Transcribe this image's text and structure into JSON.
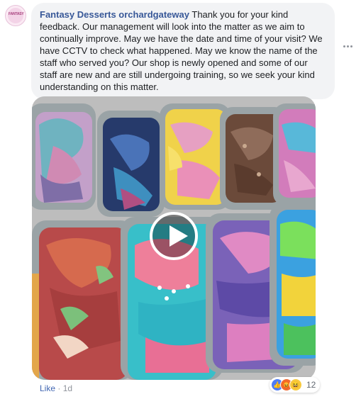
{
  "comment": {
    "author": "Fantasy Desserts orchardgateway",
    "text": "Thank you for your kind feedback. Our management will look into the matter as we aim to continually improve. May we have the date and time of your visit? We have CCTV to check what happened. May we know the name of the staff who served you? Our shop is newly opened and some of our staff are new and are still undergoing training, so we seek your kind understanding on this matter.",
    "avatar_logo_text": "FANTASY",
    "like_label": "Like",
    "separator": " · ",
    "time": "1d",
    "reaction_count": "12",
    "reactions": [
      "like-icon",
      "angry-icon",
      "haha-icon"
    ]
  },
  "media": {
    "type": "video",
    "subject": "rainbow ice cream trays",
    "play_icon": "play-icon"
  },
  "colors": {
    "author": "#385898",
    "like_link": "#4267b2",
    "bubble_bg": "#f2f3f5",
    "meta_text": "#90949c"
  }
}
